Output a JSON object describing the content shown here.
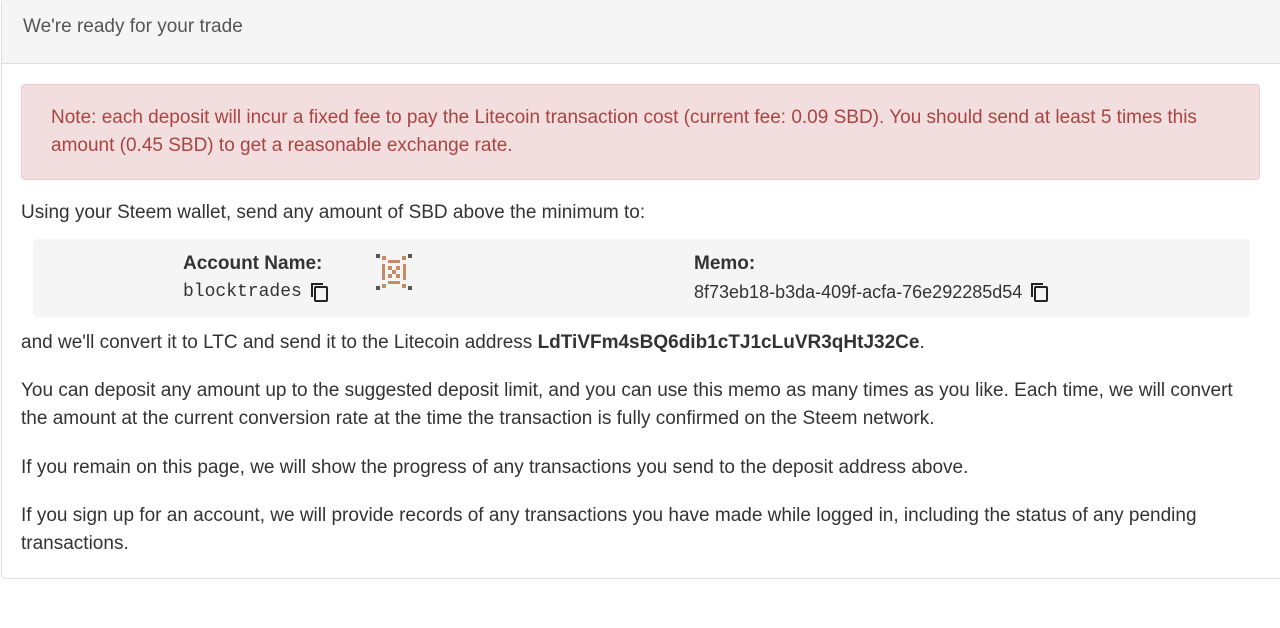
{
  "panel": {
    "heading": "We're ready for your trade"
  },
  "alert": {
    "note": "Note: each deposit will incur a fixed fee to pay the Litecoin transaction cost (current fee: 0.09 SBD). You should send at least 5 times this amount (0.45 SBD) to get a reasonable exchange rate."
  },
  "instructions": {
    "send_line": "Using your Steem wallet, send any amount of SBD above the minimum to:"
  },
  "deposit": {
    "account_label": "Account Name:",
    "account_value": "blocktrades",
    "memo_label": "Memo:",
    "memo_value": "8f73eb18-b3da-409f-acfa-76e292285d54",
    "copy_icon": "copy-icon",
    "avatar_icon": "identicon"
  },
  "convert": {
    "prefix": "and we'll convert it to LTC and send it to the Litecoin address ",
    "address": "LdTiVFm4sBQ6dib1cTJ1cLuVR3qHtJ32Ce",
    "suffix": "."
  },
  "paragraphs": {
    "limit": "You can deposit any amount up to the suggested deposit limit, and you can use this memo as many times as you like. Each time, we will convert the amount at the current conversion rate at the time the transaction is fully confirmed on the Steem network.",
    "progress": "If you remain on this page, we will show the progress of any transactions you send to the deposit address above.",
    "signup": "If you sign up for an account, we will provide records of any transactions you have made while logged in, including the status of any pending transactions."
  },
  "colors": {
    "alert_text": "#a94442",
    "alert_bg": "#f2dede",
    "well_bg": "#f5f5f5",
    "identicon": "#c98a6a"
  }
}
